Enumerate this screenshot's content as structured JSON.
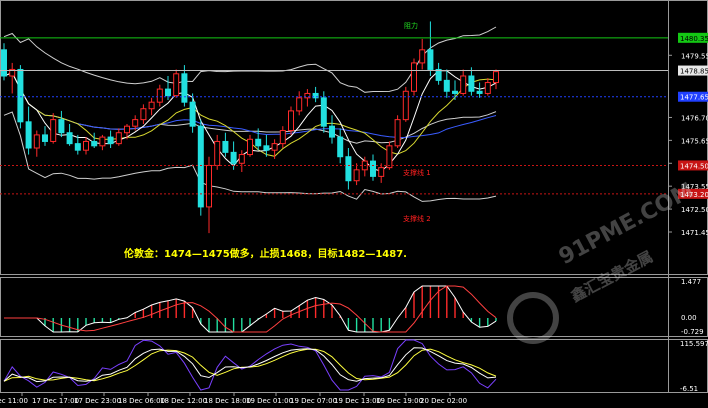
{
  "colors": {
    "bull": "#ff2a2a",
    "bear": "#22e0e0",
    "band": "#cfcfcf",
    "ma_fast": "#ffffff",
    "ma_slow": "#d8d830",
    "ma_blue": "#3a5cff",
    "hline_green": "#14c814",
    "hline_blue": "#2040ff",
    "hline_red": "#c81414",
    "macd_pos": "#ff2a2a",
    "macd_neg": "#22e0a0",
    "macd_line": "#ffffff",
    "macd_signal": "#ff4040",
    "kdj_k": "#ffffff",
    "kdj_d": "#ffff40",
    "kdj_j": "#7a40ff"
  },
  "price_axis": {
    "ticks": [
      "1479.55",
      "1476.70",
      "1475.65",
      "1474.60",
      "1473.55",
      "1472.50",
      "1471.45"
    ],
    "tags": {
      "green": "1480.35",
      "white": "1478.85",
      "blue": "1477.65",
      "red_upper": "1474.50",
      "red_lower": "1473.20"
    }
  },
  "chart_labels": {
    "resistance": "阻力",
    "support_1": "支撑线 1",
    "support_2": "支撑线 2"
  },
  "annotation": "伦敦金：1474—1475做多，止损1468，目标1482—1487.",
  "macd_axis": {
    "top": "1.477",
    "zero": "0.00",
    "bottom": "-0.729"
  },
  "kdj_axis": {
    "top": "115.5978",
    "bottom": "-6.51"
  },
  "time_axis": [
    "Dec 11:00",
    "17 Dec 17:00",
    "17 Dec 23:00",
    "18 Dec 06:00",
    "18 Dec 12:00",
    "18 Dec 18:00",
    "19 Dec 01:00",
    "19 Dec 07:00",
    "19 Dec 13:00",
    "19 Dec 19:00",
    "20 Dec 02:00"
  ],
  "watermark": {
    "brand": "91PME.COM",
    "sub": "鑫汇宝贵金属"
  },
  "chart_data": {
    "type": "candlestick",
    "title": "",
    "xlabel": "",
    "ylabel": "",
    "ylim": [
      1470.9,
      1481.9
    ],
    "candles": [
      {
        "o": 1479.8,
        "h": 1480.1,
        "l": 1478.4,
        "c": 1478.6
      },
      {
        "o": 1478.6,
        "h": 1479.2,
        "l": 1477.8,
        "c": 1478.9
      },
      {
        "o": 1478.9,
        "h": 1479.1,
        "l": 1476.2,
        "c": 1476.5
      },
      {
        "o": 1476.5,
        "h": 1477.2,
        "l": 1475.0,
        "c": 1475.3
      },
      {
        "o": 1475.3,
        "h": 1476.1,
        "l": 1474.9,
        "c": 1475.9
      },
      {
        "o": 1475.9,
        "h": 1476.3,
        "l": 1475.4,
        "c": 1475.6
      },
      {
        "o": 1475.6,
        "h": 1476.9,
        "l": 1475.5,
        "c": 1476.6
      },
      {
        "o": 1476.6,
        "h": 1477.0,
        "l": 1475.8,
        "c": 1476.0
      },
      {
        "o": 1476.0,
        "h": 1476.4,
        "l": 1475.4,
        "c": 1475.5
      },
      {
        "o": 1475.5,
        "h": 1475.9,
        "l": 1475.0,
        "c": 1475.2
      },
      {
        "o": 1475.2,
        "h": 1475.8,
        "l": 1475.0,
        "c": 1475.6
      },
      {
        "o": 1475.6,
        "h": 1476.0,
        "l": 1475.3,
        "c": 1475.4
      },
      {
        "o": 1475.4,
        "h": 1475.9,
        "l": 1475.2,
        "c": 1475.8
      },
      {
        "o": 1475.8,
        "h": 1476.1,
        "l": 1475.3,
        "c": 1475.5
      },
      {
        "o": 1475.5,
        "h": 1476.2,
        "l": 1475.4,
        "c": 1476.0
      },
      {
        "o": 1476.0,
        "h": 1476.4,
        "l": 1475.7,
        "c": 1476.3
      },
      {
        "o": 1476.3,
        "h": 1476.8,
        "l": 1476.1,
        "c": 1476.6
      },
      {
        "o": 1476.6,
        "h": 1477.3,
        "l": 1476.4,
        "c": 1477.1
      },
      {
        "o": 1477.1,
        "h": 1477.6,
        "l": 1476.8,
        "c": 1477.4
      },
      {
        "o": 1477.4,
        "h": 1478.2,
        "l": 1477.2,
        "c": 1478.0
      },
      {
        "o": 1478.0,
        "h": 1478.6,
        "l": 1477.5,
        "c": 1477.7
      },
      {
        "o": 1477.7,
        "h": 1478.9,
        "l": 1477.6,
        "c": 1478.7
      },
      {
        "o": 1478.7,
        "h": 1479.1,
        "l": 1477.2,
        "c": 1477.4
      },
      {
        "o": 1477.4,
        "h": 1477.8,
        "l": 1476.0,
        "c": 1476.3
      },
      {
        "o": 1476.3,
        "h": 1476.6,
        "l": 1472.2,
        "c": 1472.6
      },
      {
        "o": 1472.6,
        "h": 1474.9,
        "l": 1471.4,
        "c": 1474.5
      },
      {
        "o": 1474.5,
        "h": 1475.9,
        "l": 1474.3,
        "c": 1475.6
      },
      {
        "o": 1475.6,
        "h": 1476.0,
        "l": 1474.9,
        "c": 1475.1
      },
      {
        "o": 1475.1,
        "h": 1475.6,
        "l": 1474.3,
        "c": 1474.6
      },
      {
        "o": 1474.6,
        "h": 1475.2,
        "l": 1474.2,
        "c": 1475.0
      },
      {
        "o": 1475.0,
        "h": 1475.9,
        "l": 1474.9,
        "c": 1475.7
      },
      {
        "o": 1475.7,
        "h": 1476.2,
        "l": 1475.2,
        "c": 1475.4
      },
      {
        "o": 1475.4,
        "h": 1475.9,
        "l": 1474.9,
        "c": 1475.2
      },
      {
        "o": 1475.2,
        "h": 1475.7,
        "l": 1474.8,
        "c": 1475.5
      },
      {
        "o": 1475.5,
        "h": 1476.3,
        "l": 1475.3,
        "c": 1476.1
      },
      {
        "o": 1476.1,
        "h": 1477.2,
        "l": 1475.9,
        "c": 1477.0
      },
      {
        "o": 1477.0,
        "h": 1477.9,
        "l": 1476.8,
        "c": 1477.6
      },
      {
        "o": 1477.6,
        "h": 1478.0,
        "l": 1477.2,
        "c": 1477.8
      },
      {
        "o": 1477.8,
        "h": 1478.1,
        "l": 1477.4,
        "c": 1477.6
      },
      {
        "o": 1477.6,
        "h": 1477.9,
        "l": 1476.0,
        "c": 1476.3
      },
      {
        "o": 1476.3,
        "h": 1476.8,
        "l": 1475.5,
        "c": 1475.8
      },
      {
        "o": 1475.8,
        "h": 1476.2,
        "l": 1474.6,
        "c": 1474.9
      },
      {
        "o": 1474.9,
        "h": 1475.3,
        "l": 1473.4,
        "c": 1473.8
      },
      {
        "o": 1473.8,
        "h": 1474.6,
        "l": 1473.6,
        "c": 1474.3
      },
      {
        "o": 1474.3,
        "h": 1474.9,
        "l": 1474.0,
        "c": 1474.7
      },
      {
        "o": 1474.7,
        "h": 1475.0,
        "l": 1473.8,
        "c": 1474.0
      },
      {
        "o": 1474.0,
        "h": 1474.6,
        "l": 1473.7,
        "c": 1474.4
      },
      {
        "o": 1474.4,
        "h": 1475.6,
        "l": 1474.3,
        "c": 1475.4
      },
      {
        "o": 1475.4,
        "h": 1476.8,
        "l": 1475.3,
        "c": 1476.6
      },
      {
        "o": 1476.6,
        "h": 1478.1,
        "l": 1476.5,
        "c": 1477.9
      },
      {
        "o": 1477.9,
        "h": 1479.4,
        "l": 1477.7,
        "c": 1479.2
      },
      {
        "o": 1479.2,
        "h": 1480.3,
        "l": 1478.9,
        "c": 1479.8
      },
      {
        "o": 1479.8,
        "h": 1481.1,
        "l": 1478.6,
        "c": 1478.9
      },
      {
        "o": 1478.9,
        "h": 1479.2,
        "l": 1478.2,
        "c": 1478.4
      },
      {
        "o": 1478.4,
        "h": 1478.9,
        "l": 1477.6,
        "c": 1477.9
      },
      {
        "o": 1477.9,
        "h": 1478.4,
        "l": 1477.5,
        "c": 1477.8
      },
      {
        "o": 1477.8,
        "h": 1478.9,
        "l": 1477.7,
        "c": 1478.6
      },
      {
        "o": 1478.6,
        "h": 1479.0,
        "l": 1477.7,
        "c": 1477.9
      },
      {
        "o": 1477.9,
        "h": 1478.3,
        "l": 1477.6,
        "c": 1477.8
      },
      {
        "o": 1477.8,
        "h": 1478.5,
        "l": 1477.7,
        "c": 1478.3
      },
      {
        "o": 1478.3,
        "h": 1478.9,
        "l": 1478.0,
        "c": 1478.8
      }
    ],
    "lines": {
      "green": 1480.35,
      "white": 1478.85,
      "blue": 1477.65,
      "red_upper": 1474.5,
      "red_lower": 1473.2
    }
  }
}
